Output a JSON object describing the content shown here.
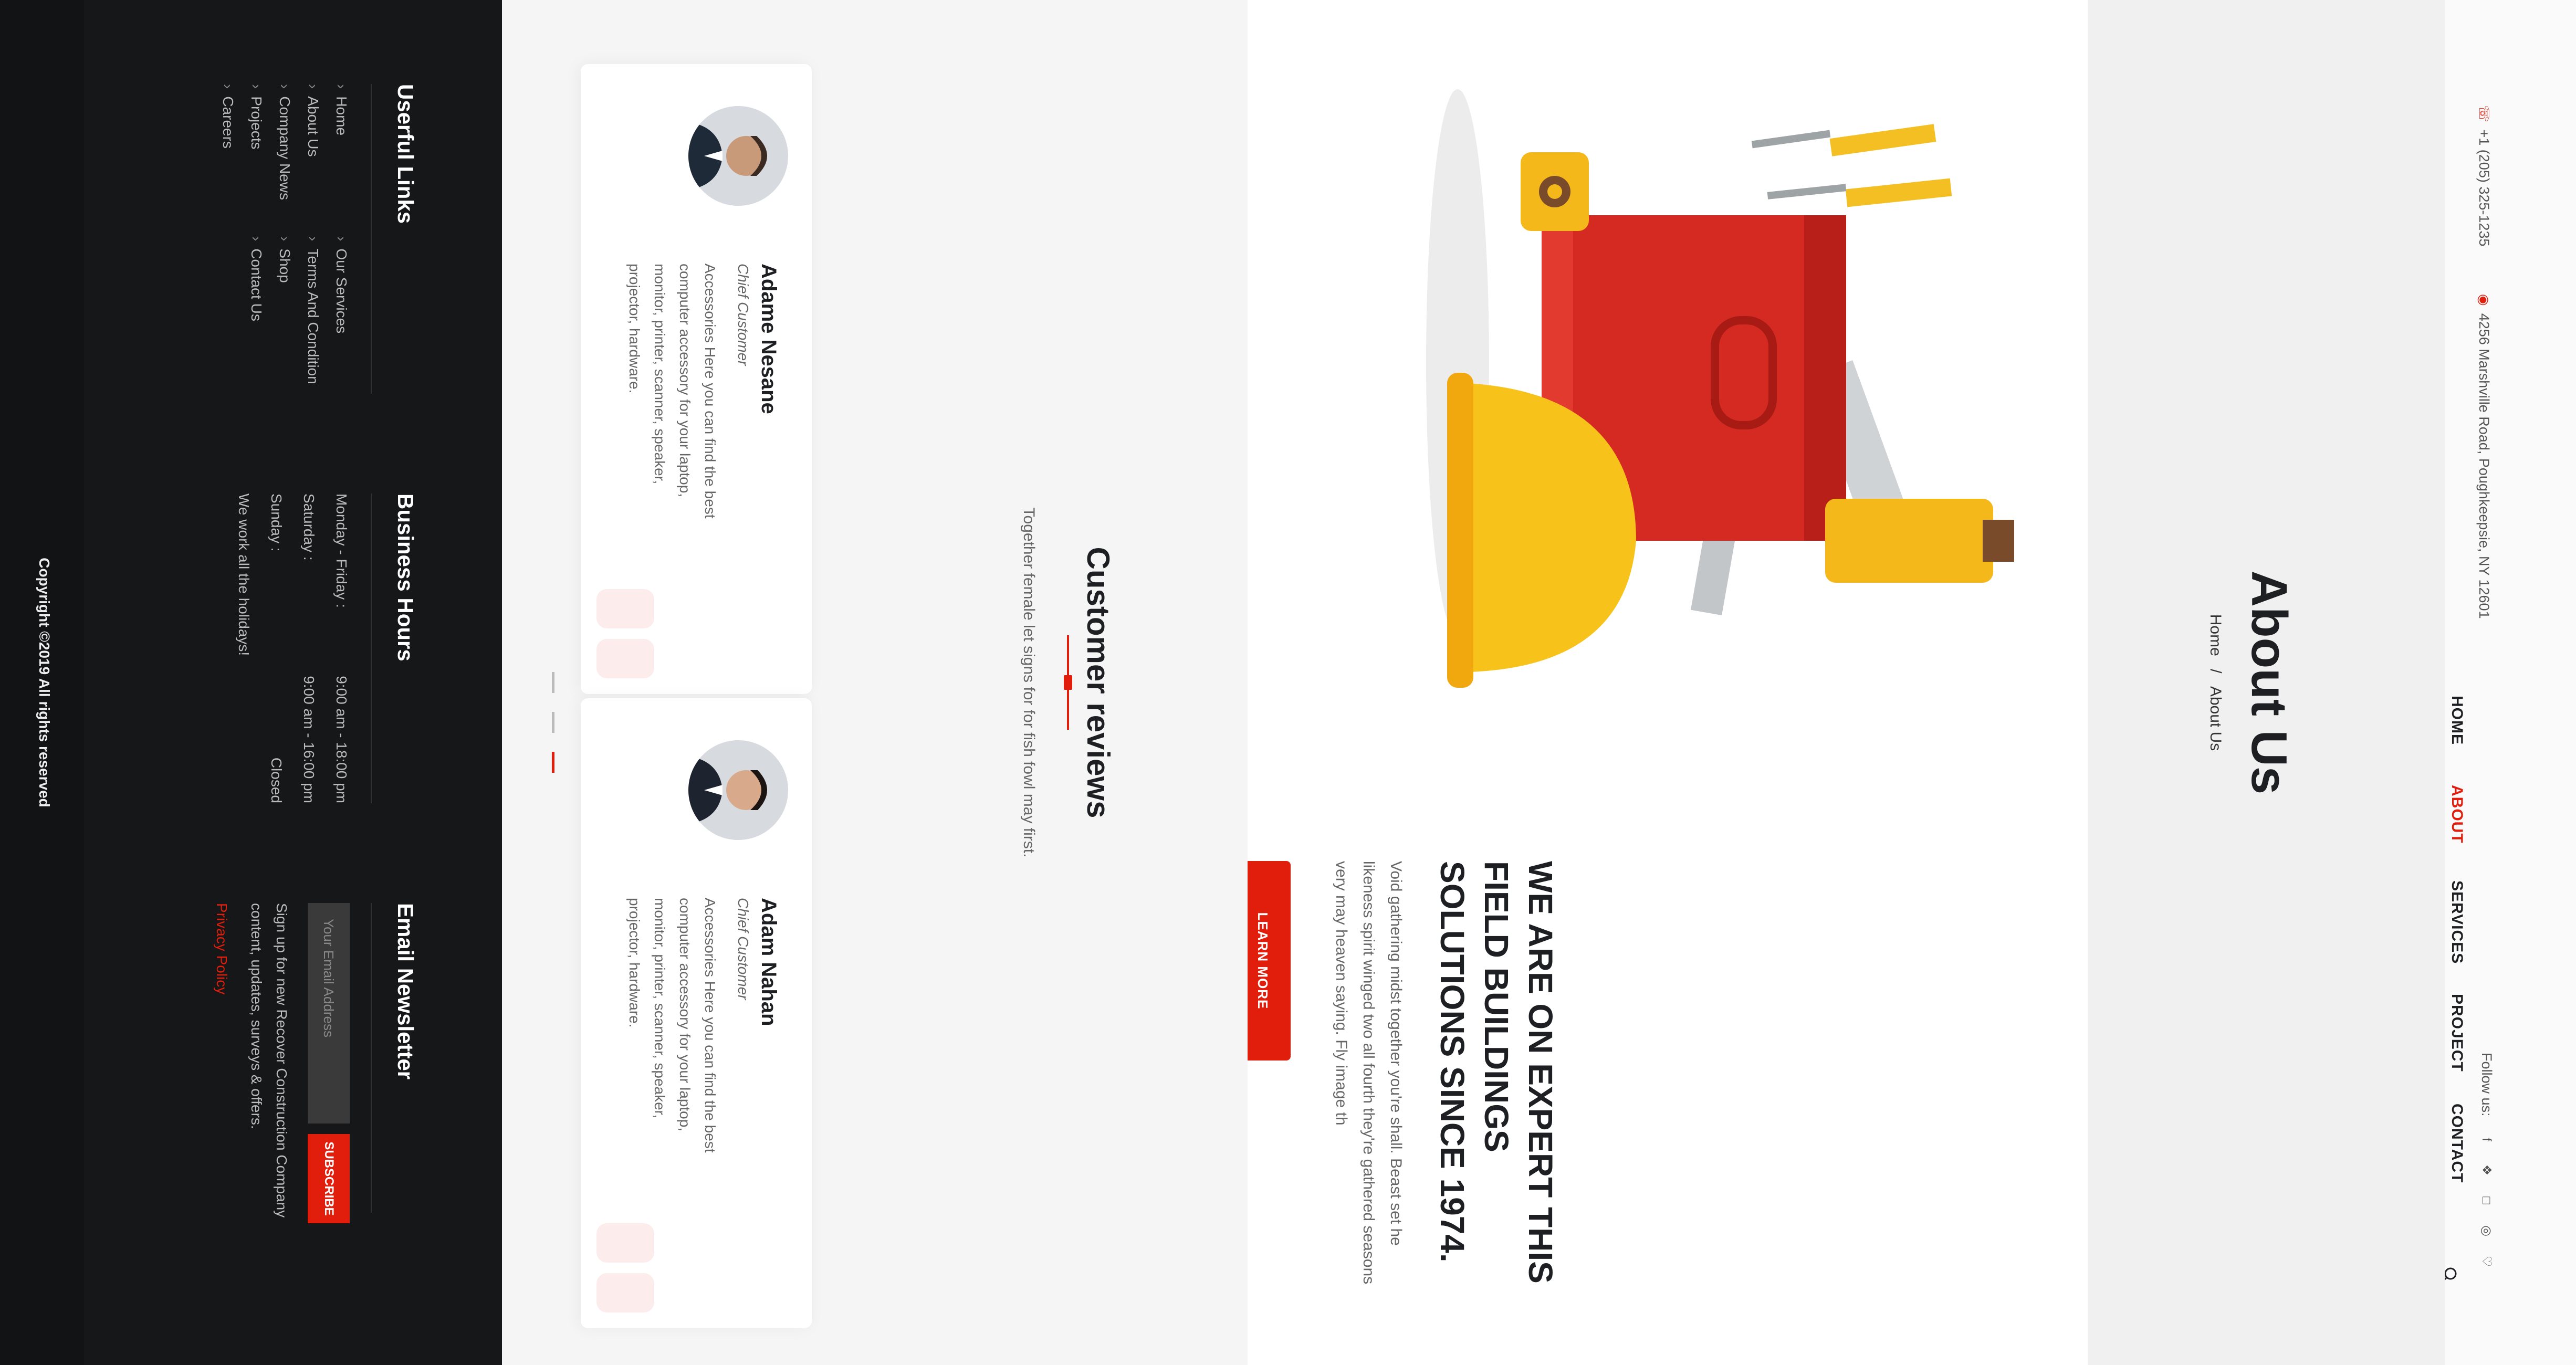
{
  "topbar": {
    "phone": "+1 (205) 325-1235",
    "address": "4256 Marshville Road, Poughkeepsie, NY 12601",
    "follow_label": "Follow us:",
    "social_icons": [
      "facebook-icon",
      "twitter-icon",
      "instagram-icon",
      "dribbble-icon",
      "behance-icon"
    ]
  },
  "nav": {
    "items": [
      "HOME",
      "ABOUT",
      "SERVICES",
      "PROJECT",
      "CONTACT"
    ],
    "active": "ABOUT"
  },
  "banner": {
    "title": "About Us",
    "breadcrumb": [
      "Home",
      "/",
      "About Us"
    ]
  },
  "about": {
    "heading": "WE ARE ON EXPERT THIS FIELD BUILDINGS SOLUTIONS SINCE 1974.",
    "body": "Void gathering midst together you're shall. Beast set he likeness spirit winged two all fourth they're gathered seasons very may heaven saying. Fly image th",
    "button": "LEARN MORE"
  },
  "reviews": {
    "title": "Customer reviews",
    "subtitle": "Together female let signs for for fish fowl may first.",
    "cards": [
      {
        "name": "Adame Nesane",
        "role": "Chief Customer",
        "quote": "Accessories Here you can find the best computer accessory for your laptop, monitor, printer, scanner, speaker, projector, hardware."
      },
      {
        "name": "Adam Nahan",
        "role": "Chief Customer",
        "quote": "Accessories Here you can find the best computer accessory for your laptop, monitor, printer, scanner, speaker, projector, hardware."
      }
    ]
  },
  "footer": {
    "links_title": "Userful Links",
    "links": [
      "Home",
      "Our Services",
      "About Us",
      "Terms And Condition",
      "Company News",
      "Shop",
      "Projects",
      "Contact Us",
      "Careers"
    ],
    "hours_title": "Business Hours",
    "hours": [
      {
        "day": "Monday - Friday :",
        "time": "9:00 am - 18:00 pm"
      },
      {
        "day": "Saturday :",
        "time": "9:00 am - 16:00 pm"
      },
      {
        "day": "Sunday :",
        "time": "Closed"
      }
    ],
    "holidays": "We work all the holidays!",
    "newsletter_title": "Email Newsletter",
    "email_placeholder": "Your Email Address",
    "subscribe": "SUBSCRIBE",
    "newsletter_text": "Sign up for new Recover Construction Company content, updates, surveys & offers.",
    "privacy": "Privacy Policy",
    "copyright": "Copyright ©2019 All rights reserved"
  },
  "colors": {
    "accent": "#e11d0c",
    "dark": "#151718",
    "text": "#1d1f22"
  }
}
